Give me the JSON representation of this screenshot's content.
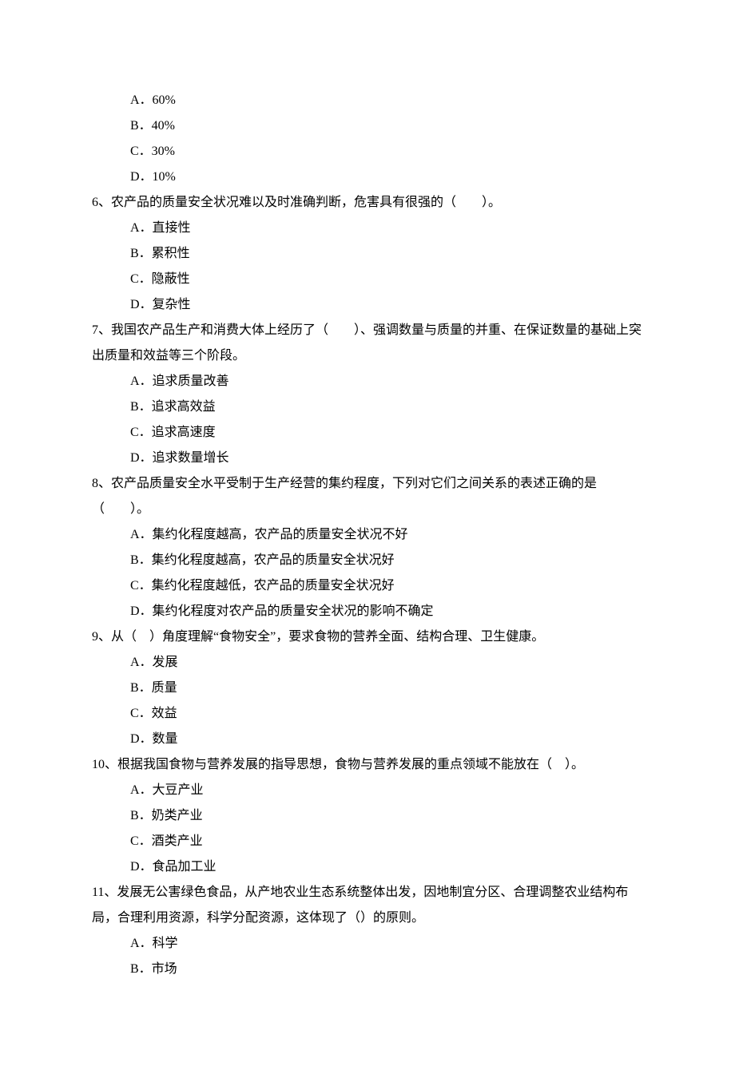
{
  "q5": {
    "optA": "A．60%",
    "optB": "B．40%",
    "optC": "C．30%",
    "optD": "D．10%"
  },
  "q6": {
    "stem": "6、农产品的质量安全状况难以及时准确判断，危害具有很强的（　　）。",
    "optA": "A．直接性",
    "optB": "B．累积性",
    "optC": "C．隐蔽性",
    "optD": "D．复杂性"
  },
  "q7": {
    "stem": "7、我国农产品生产和消费大体上经历了（　　）、强调数量与质量的并重、在保证数量的基础上突出质量和效益等三个阶段。",
    "optA": "A．追求质量改善",
    "optB": "B．追求高效益",
    "optC": "C．追求高速度",
    "optD": "D．追求数量增长"
  },
  "q8": {
    "stem": "8、农产品质量安全水平受制于生产经营的集约程度，下列对它们之间关系的表述正确的是（　　）。",
    "optA": "A．集约化程度越高，农产品的质量安全状况不好",
    "optB": "B．集约化程度越高，农产品的质量安全状况好",
    "optC": "C．集约化程度越低，农产品的质量安全状况好",
    "optD": "D．集约化程度对农产品的质量安全状况的影响不确定"
  },
  "q9": {
    "stem": "9、从（　）角度理解“食物安全”，要求食物的营养全面、结构合理、卫生健康。",
    "optA": "A．发展",
    "optB": "B．质量",
    "optC": "C．效益",
    "optD": "D．数量"
  },
  "q10": {
    "stem": "10、根据我国食物与营养发展的指导思想，食物与营养发展的重点领域不能放在（　）。",
    "optA": "A．大豆产业",
    "optB": "B．奶类产业",
    "optC": "C．酒类产业",
    "optD": "D．食品加工业"
  },
  "q11": {
    "stem": "11、发展无公害绿色食品，从产地农业生态系统整体出发，因地制宜分区、合理调整农业结构布局，合理利用资源，科学分配资源，这体现了（）的原则。",
    "optA": "A．科学",
    "optB": "B．市场"
  }
}
